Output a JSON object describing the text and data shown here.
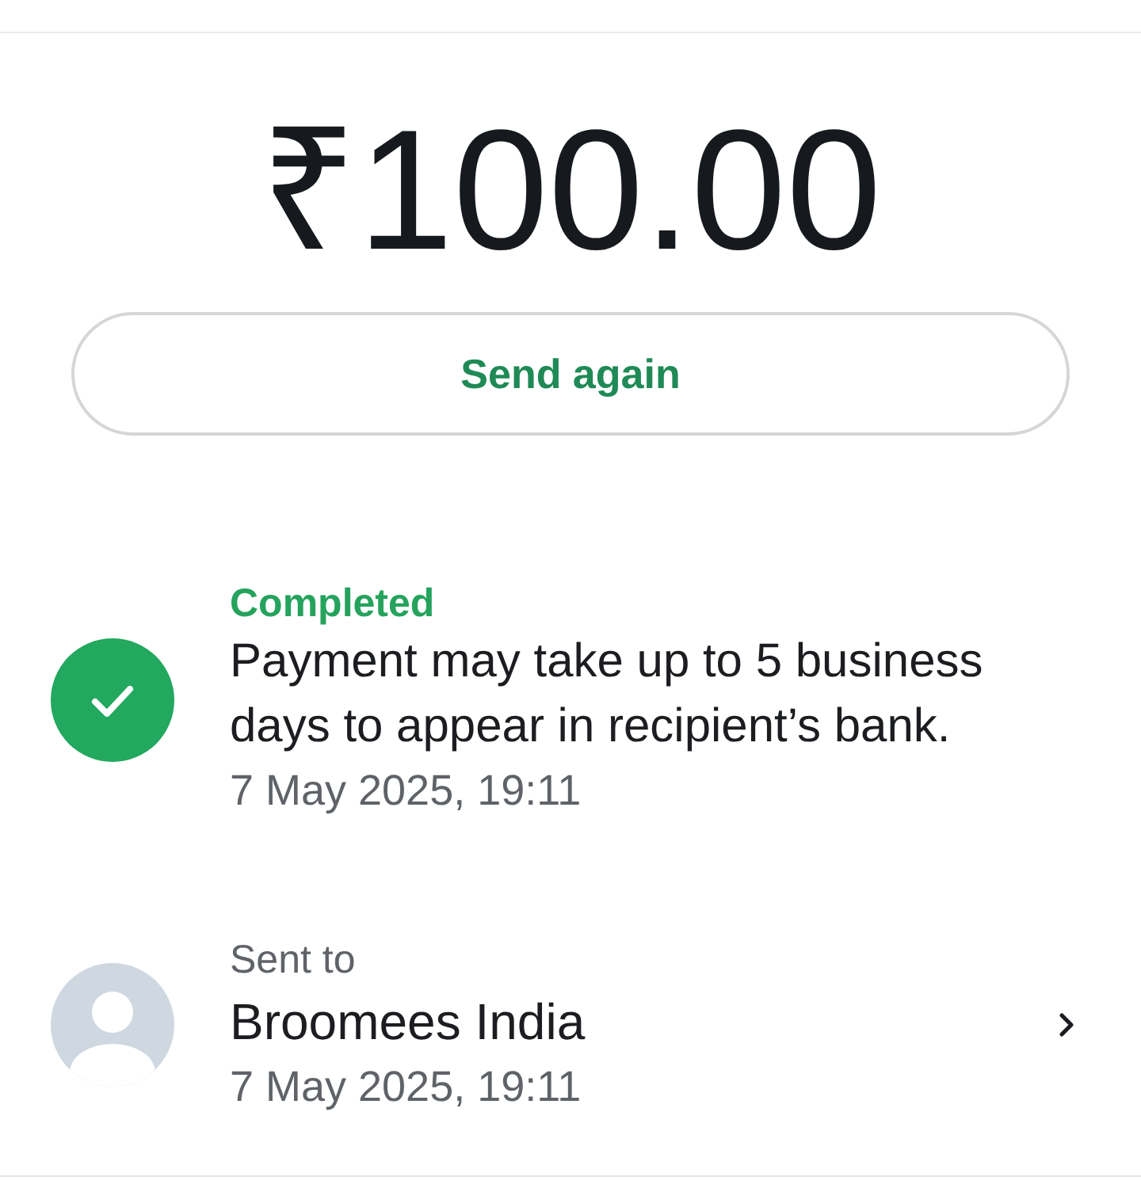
{
  "amount": "₹100.00",
  "send_again_button": {
    "label": "Send again"
  },
  "status": {
    "kind": "completed",
    "label": "Completed",
    "message": "Payment may take up to 5 business days to appear in recipient’s bank.",
    "timestamp": "7 May 2025, 19:11"
  },
  "recipient": {
    "label": "Sent to",
    "name": "Broomees India",
    "timestamp": "7 May 2025, 19:11"
  }
}
